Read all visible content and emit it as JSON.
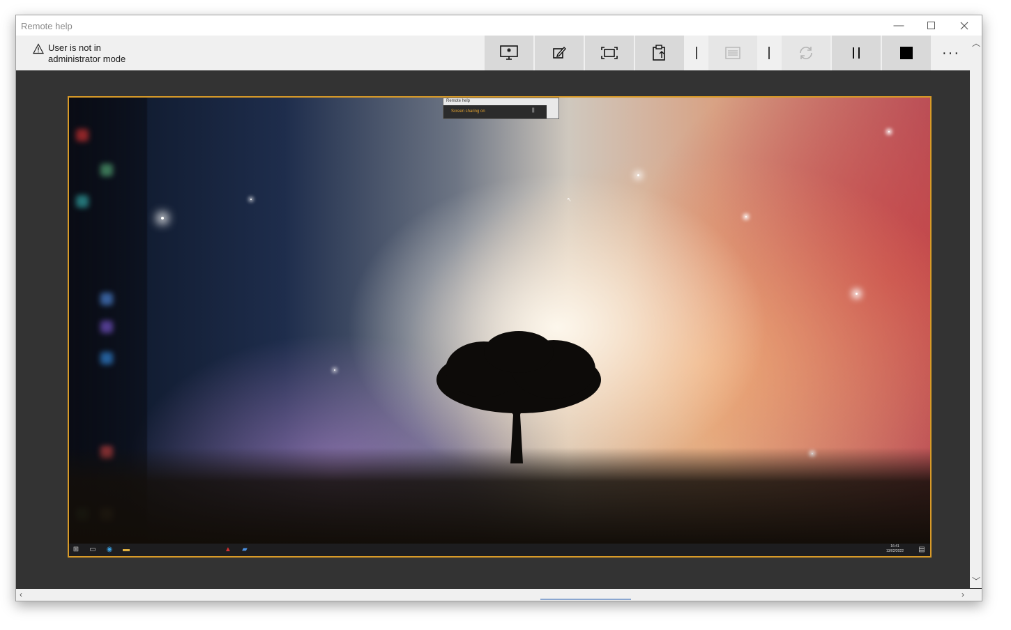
{
  "window": {
    "title": "Remote help"
  },
  "toolbar": {
    "warning": "User is not in\nadministrator mode",
    "more_label": "···"
  },
  "remote_screen": {
    "mini_window_title": "Remote help",
    "mini_status": "Screen sharing on",
    "clock_time": "16:41",
    "clock_date": "13/02/2022"
  },
  "colors": {
    "frame": "#d89a28",
    "toolbar": "#f0f0f0",
    "button": "#d9d9d9",
    "canvas": "#333333"
  }
}
